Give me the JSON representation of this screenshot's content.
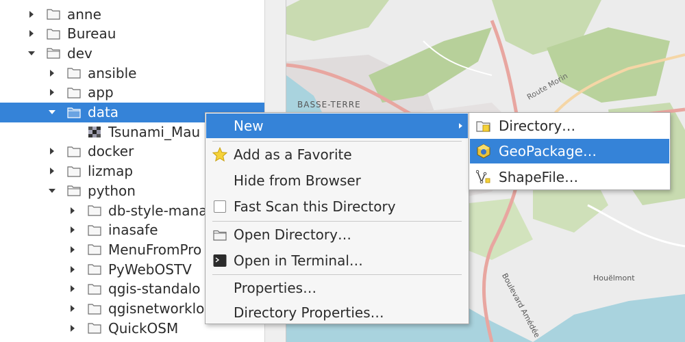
{
  "tree": {
    "items": [
      {
        "label": "anne",
        "depth": 1,
        "expanded": false
      },
      {
        "label": "Bureau",
        "depth": 1,
        "expanded": false
      },
      {
        "label": "dev",
        "depth": 1,
        "expanded": true
      },
      {
        "label": "ansible",
        "depth": 2,
        "expanded": false
      },
      {
        "label": "app",
        "depth": 2,
        "expanded": false
      },
      {
        "label": "data",
        "depth": 2,
        "expanded": true,
        "selected": true
      },
      {
        "label": "Tsunami_Mau",
        "depth": 3,
        "type": "raster"
      },
      {
        "label": "docker",
        "depth": 2,
        "expanded": false
      },
      {
        "label": "lizmap",
        "depth": 2,
        "expanded": false
      },
      {
        "label": "python",
        "depth": 2,
        "expanded": true
      },
      {
        "label": "db-style-mana",
        "depth": 3,
        "expanded": false
      },
      {
        "label": "inasafe",
        "depth": 3,
        "expanded": false
      },
      {
        "label": "MenuFromPro",
        "depth": 3,
        "expanded": false
      },
      {
        "label": "PyWebOSTV",
        "depth": 3,
        "expanded": false
      },
      {
        "label": "qgis-standalo",
        "depth": 3,
        "expanded": false
      },
      {
        "label": "qgisnetworklo",
        "depth": 3,
        "expanded": false
      },
      {
        "label": "QuickOSM",
        "depth": 3,
        "expanded": false
      }
    ]
  },
  "map": {
    "place_label": "BASSE-TERRE",
    "road_label_1": "Route Morin",
    "road_label_2": "Boulevard Amédée",
    "poi_label": "Houëlmont"
  },
  "context_menu": {
    "new": "New",
    "add_favorite": "Add as a Favorite",
    "hide_browser": "Hide from Browser",
    "fast_scan": "Fast Scan this Directory",
    "open_directory": "Open Directory…",
    "open_terminal": "Open in Terminal…",
    "properties": "Properties…",
    "directory_properties": "Directory Properties…"
  },
  "submenu": {
    "directory": "Directory…",
    "geopackage": "GeoPackage…",
    "shapefile": "ShapeFile…"
  },
  "colors": {
    "selection": "#3583d8",
    "map_background": "#ececec"
  }
}
